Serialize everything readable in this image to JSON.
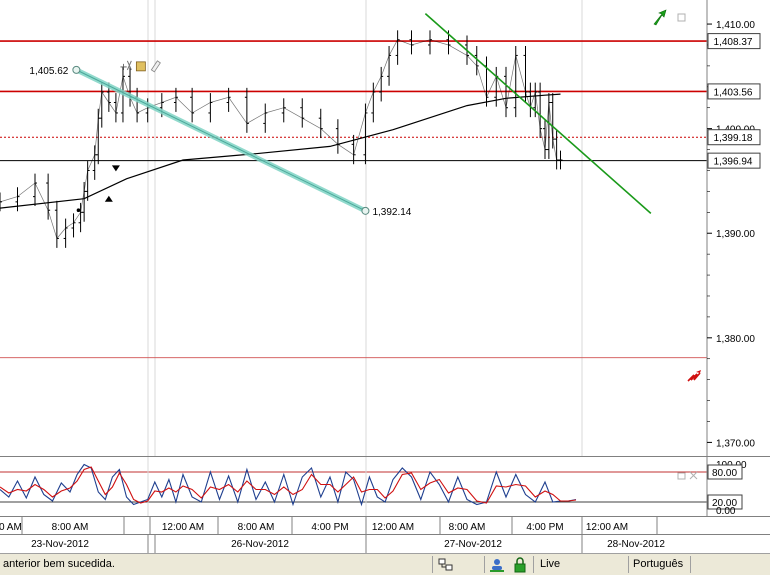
{
  "colors": {
    "background": "#ffffff",
    "price": "#000000",
    "moving_average": "#000000",
    "resistance_line": "#cc0000",
    "trend_line": "#1a9a1a",
    "channel_line": "#7fd4c4",
    "stoch_k": "#1f3f8f",
    "stoch_d": "#d01010",
    "axis_panel": "#ffffff"
  },
  "chart_data": [
    {
      "type": "line",
      "panel": "price",
      "ylim": [
        1368.7,
        1412.3
      ],
      "y_ticks": [
        "1,410.00",
        "1,400.00",
        "1,390.00",
        "1,380.00",
        "1,370.00"
      ],
      "y_tick_values": [
        1410,
        1400,
        1390,
        1380,
        1370
      ],
      "x_tick_labels": [
        "8:00 AM",
        "12:00 AM",
        "8:00 AM",
        "4:00 PM",
        "12:00 AM",
        "8:00 AM",
        "4:00 PM",
        "12:00 AM"
      ],
      "x_tick_hours": [
        32,
        48,
        56,
        64,
        72,
        80,
        88,
        96
      ],
      "date_labels": [
        "23-Nov-2012",
        "26-Nov-2012",
        "27-Nov-2012",
        "28-Nov-2012"
      ],
      "date_label_hours": [
        24,
        56,
        88,
        112
      ],
      "x_range_hours": [
        24,
        110.2
      ],
      "price_series": {
        "x_hours": [
          24.0,
          26.0,
          28.0,
          29.5,
          30.5,
          31.5,
          32.5,
          33.5,
          34.0,
          34.5,
          35.5,
          36.0,
          36.5,
          37.5,
          38.5,
          39.5,
          40.5,
          41.5,
          43.0,
          45.0,
          47.0,
          49.0,
          51.0,
          53.0,
          55.0,
          57.0,
          59.0,
          61.0,
          63.0,
          65.0,
          67.0,
          68.5,
          69.5,
          70.5,
          71.5,
          72.5,
          74.0,
          76.0,
          78.0,
          80.0,
          81.0,
          82.0,
          83.0,
          84.0,
          85.0,
          86.0,
          86.5,
          87.0,
          87.5,
          88.0,
          88.5,
          89.0,
          89.5,
          90.0
        ],
        "close": [
          1393.0,
          1393.5,
          1394.8,
          1392.2,
          1389.5,
          1390.5,
          1391.0,
          1392.0,
          1394.0,
          1396.0,
          1397.5,
          1401.0,
          1403.5,
          1402.5,
          1401.5,
          1405.0,
          1403.0,
          1401.5,
          1402.0,
          1402.5,
          1403.0,
          1401.5,
          1402.5,
          1403.0,
          1400.5,
          1401.5,
          1402.0,
          1401.0,
          1400.0,
          1398.5,
          1397.5,
          1401.5,
          1403.5,
          1405.0,
          1407.0,
          1408.5,
          1408.0,
          1408.5,
          1408.0,
          1407.0,
          1406.0,
          1403.0,
          1405.0,
          1402.0,
          1407.0,
          1403.5,
          1402.0,
          1403.5,
          1400.0,
          1398.0,
          1402.5,
          1399.0,
          1397.0,
          1397.0
        ]
      },
      "moving_average": {
        "x_hours": [
          24,
          34,
          40,
          48,
          56,
          64,
          72,
          80,
          84,
          88,
          90
        ],
        "values": [
          1392.4,
          1393.3,
          1395.2,
          1397.0,
          1397.6,
          1398.3,
          1399.9,
          1402.2,
          1402.9,
          1403.2,
          1403.3
        ]
      },
      "horizontal_levels": [
        {
          "value": 1408.37,
          "label": "1,408.37",
          "style": "solid-red"
        },
        {
          "value": 1403.56,
          "label": "1,403.56",
          "style": "solid-red"
        },
        {
          "value": 1399.18,
          "label": "1,399.18",
          "style": "dotted-red"
        },
        {
          "value": 1396.94,
          "label": "1,396.94",
          "style": "solid-black"
        },
        {
          "value": 1378.1,
          "label": "",
          "style": "thin-red"
        }
      ],
      "channel_line": {
        "start": {
          "hour": 32.9,
          "value": 1405.62,
          "label": "1,405.62"
        },
        "end": {
          "hour": 68.5,
          "value": 1392.14,
          "label": "1,392.14"
        }
      },
      "trend_line": {
        "start": {
          "hour": 75.5,
          "value": 1411.0
        },
        "end": {
          "hour": 102.1,
          "value": 1391.9
        }
      },
      "markers": [
        {
          "hour": 38.5,
          "value": 1396.2,
          "shape": "triangle-down"
        },
        {
          "hour": 37.5,
          "value": 1393.3,
          "shape": "triangle-up"
        }
      ],
      "toolbar_icons": [
        "crosshair-icon",
        "scissors-icon",
        "eraser-icon"
      ],
      "corner_icons": [
        "green-arrow-icon",
        "red-zigzag-icon"
      ]
    },
    {
      "type": "line",
      "panel": "stochastic",
      "ylim": [
        0,
        100
      ],
      "y_ticks": [
        "100.00",
        "80.00",
        "20.00",
        "0.00"
      ],
      "y_tick_values": [
        100,
        80,
        20,
        0
      ],
      "level_lines": [
        80,
        20
      ],
      "x_range_hours": [
        24,
        110.2
      ],
      "series": [
        {
          "name": "",
          "color": "#1f3f8f",
          "x_hours": [
            24,
            25,
            26,
            27,
            28,
            29,
            30,
            31,
            32,
            33,
            34,
            35,
            36,
            37,
            38,
            39,
            40,
            41,
            42,
            43,
            44,
            45,
            46,
            47,
            48,
            49,
            50,
            51,
            52,
            53,
            54,
            55,
            56,
            57,
            58,
            59,
            60,
            61,
            62,
            63,
            64,
            65,
            66,
            67,
            68,
            69,
            70,
            71,
            72,
            73,
            74,
            75,
            76,
            77,
            78,
            79,
            80,
            81,
            82,
            83,
            84,
            85,
            86,
            87,
            88,
            89,
            90,
            91,
            92
          ],
          "values": [
            45,
            30,
            62,
            28,
            70,
            35,
            22,
            58,
            40,
            75,
            95,
            88,
            40,
            25,
            70,
            85,
            30,
            15,
            20,
            25,
            60,
            30,
            65,
            20,
            75,
            30,
            20,
            80,
            25,
            72,
            20,
            85,
            25,
            60,
            20,
            75,
            15,
            70,
            88,
            30,
            70,
            20,
            80,
            65,
            15,
            70,
            30,
            20,
            65,
            88,
            70,
            25,
            80,
            55,
            20,
            70,
            25,
            15,
            20,
            80,
            30,
            75,
            35,
            20,
            60,
            20,
            22,
            22,
            25
          ]
        },
        {
          "name": "",
          "color": "#d01010",
          "x_hours": [
            24,
            25,
            26,
            27,
            28,
            29,
            30,
            31,
            32,
            33,
            34,
            35,
            36,
            37,
            38,
            39,
            40,
            41,
            42,
            43,
            44,
            45,
            46,
            47,
            48,
            49,
            50,
            51,
            52,
            53,
            54,
            55,
            56,
            57,
            58,
            59,
            60,
            61,
            62,
            63,
            64,
            65,
            66,
            67,
            68,
            69,
            70,
            71,
            72,
            73,
            74,
            75,
            76,
            77,
            78,
            79,
            80,
            81,
            82,
            83,
            84,
            85,
            86,
            87,
            88,
            89,
            90,
            91,
            92
          ],
          "values": [
            50,
            38,
            45,
            42,
            55,
            45,
            30,
            42,
            48,
            62,
            85,
            90,
            62,
            35,
            50,
            78,
            55,
            25,
            18,
            22,
            42,
            40,
            48,
            40,
            52,
            45,
            28,
            50,
            45,
            55,
            40,
            62,
            45,
            45,
            35,
            50,
            35,
            45,
            75,
            55,
            55,
            40,
            55,
            70,
            40,
            45,
            45,
            28,
            42,
            75,
            78,
            45,
            58,
            65,
            38,
            48,
            45,
            22,
            18,
            52,
            50,
            55,
            52,
            30,
            42,
            35,
            22,
            22,
            24
          ]
        }
      ]
    }
  ],
  "price_axis_labels": {
    "t1410": "1,410.00",
    "t1390": "1,390.00",
    "t1380": "1,380.00",
    "t1370": "1,370.00"
  },
  "stoch_axis_labels": {
    "t100": "100.00",
    "t80": "80.00",
    "t20": "20.00",
    "t0": "0.00"
  },
  "time_axis_labels": [
    "0 AM",
    "8:00 AM",
    "12:00 AM",
    "8:00 AM",
    "4:00 PM",
    "12:00 AM",
    "8:00 AM",
    "4:00 PM",
    "12:00 AM"
  ],
  "date_axis_labels": [
    "23-Nov-2012",
    "26-Nov-2012",
    "27-Nov-2012",
    "28-Nov-2012"
  ],
  "status_bar": {
    "message": "anterior bem sucedida.",
    "connection": "Live",
    "language": "Português"
  }
}
